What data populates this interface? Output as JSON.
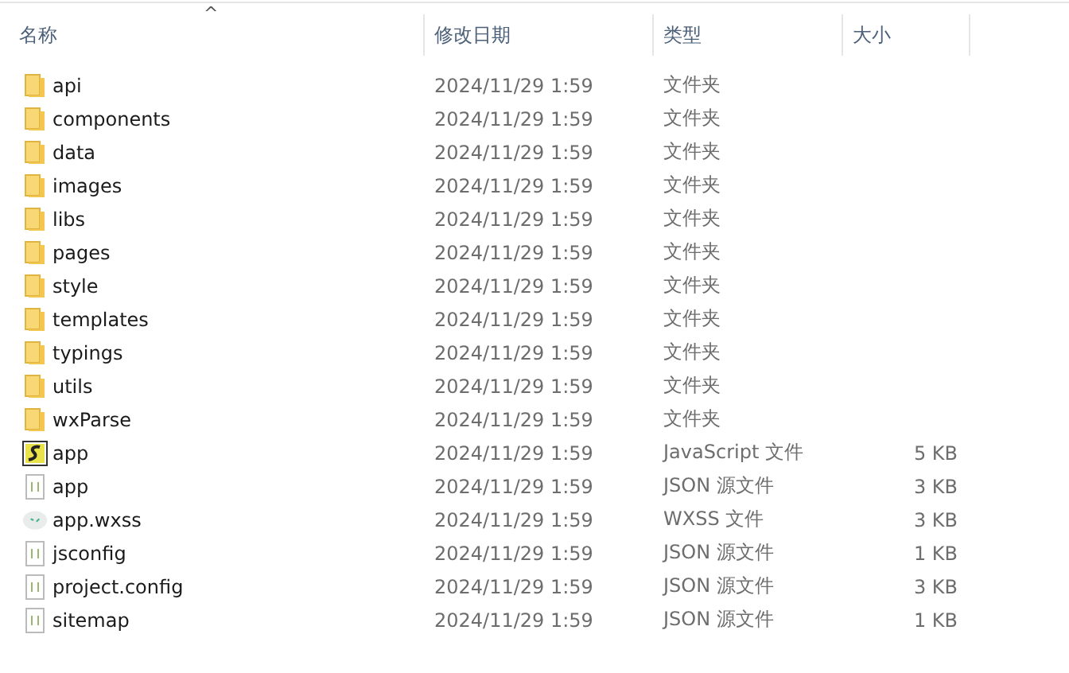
{
  "columns": [
    {
      "label": "名称",
      "sort_indicator": "^"
    },
    {
      "label": "修改日期"
    },
    {
      "label": "类型"
    },
    {
      "label": "大小"
    }
  ],
  "rows": [
    {
      "kind": "folder",
      "name": "api",
      "date": "2024/11/29 1:59",
      "type": "文件夹"
    },
    {
      "kind": "folder",
      "name": "components",
      "date": "2024/11/29 1:59",
      "type": "文件夹"
    },
    {
      "kind": "folder",
      "name": "data",
      "date": "2024/11/29 1:59",
      "type": "文件夹"
    },
    {
      "kind": "folder",
      "name": "images",
      "date": "2024/11/29 1:59",
      "type": "文件夹"
    },
    {
      "kind": "folder",
      "name": "libs",
      "date": "2024/11/29 1:59",
      "type": "文件夹"
    },
    {
      "kind": "folder",
      "name": "pages",
      "date": "2024/11/29 1:59",
      "type": "文件夹"
    },
    {
      "kind": "folder",
      "name": "style",
      "date": "2024/11/29 1:59",
      "type": "文件夹"
    },
    {
      "kind": "folder",
      "name": "templates",
      "date": "2024/11/29 1:59",
      "type": "文件夹"
    },
    {
      "kind": "folder",
      "name": "typings",
      "date": "2024/11/29 1:59",
      "type": "文件夹"
    },
    {
      "kind": "folder",
      "name": "utils",
      "date": "2024/11/29 1:59",
      "type": "文件夹"
    },
    {
      "kind": "folder",
      "name": "wxParse",
      "date": "2024/11/29 1:59",
      "type": "文件夹"
    },
    {
      "kind": "script",
      "name": "app",
      "date": "2024/11/29 1:59",
      "type": "JavaScript 文件",
      "size": "5 KB"
    },
    {
      "kind": "json",
      "name": "app",
      "date": "2024/11/29 1:59",
      "type": "JSON 源文件",
      "size": "3 KB"
    },
    {
      "kind": "wxss",
      "name": "app.wxss",
      "date": "2024/11/29 1:59",
      "type": "WXSS 文件",
      "size": "3 KB"
    },
    {
      "kind": "json",
      "name": "jsconfig",
      "date": "2024/11/29 1:59",
      "type": "JSON 源文件",
      "size": "1 KB"
    },
    {
      "kind": "json",
      "name": "project.config",
      "date": "2024/11/29 1:59",
      "type": "JSON 源文件",
      "size": "3 KB"
    },
    {
      "kind": "json",
      "name": "sitemap",
      "date": "2024/11/29 1:59",
      "type": "JSON 源文件",
      "size": "1 KB"
    }
  ]
}
